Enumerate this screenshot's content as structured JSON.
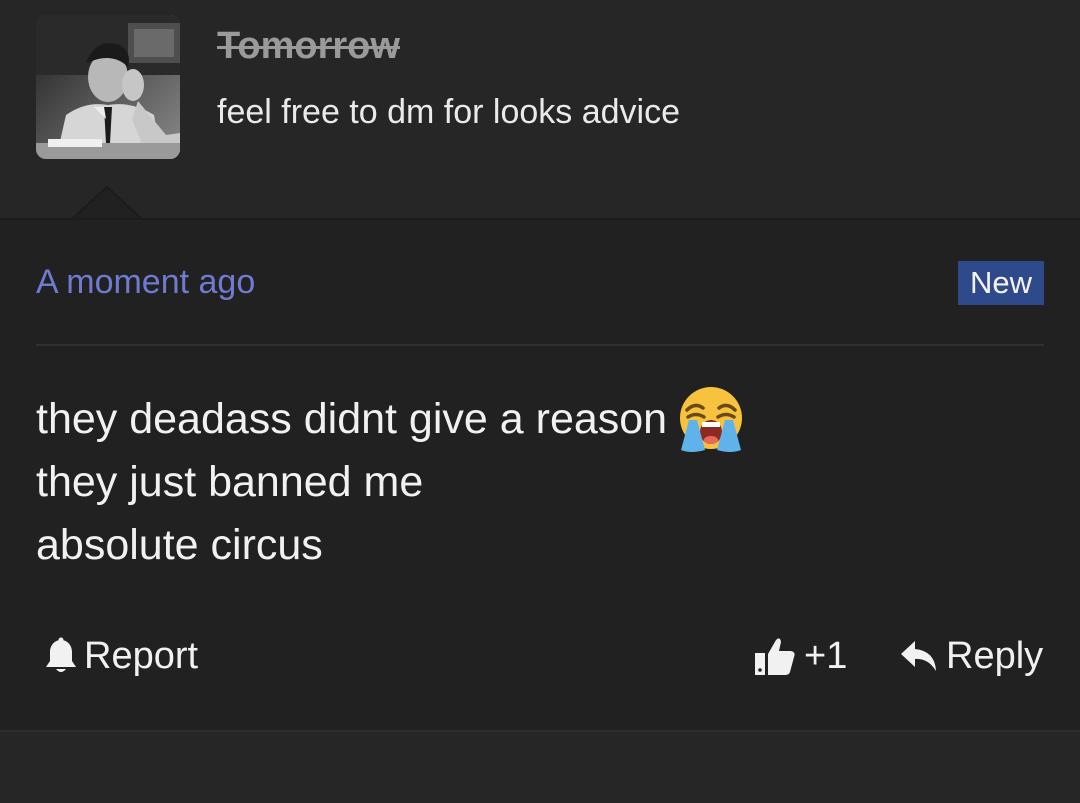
{
  "profile": {
    "username": "Tomorrow",
    "bio": "feel free to dm for looks advice",
    "avatar_icon": "profile-photo"
  },
  "comment": {
    "timestamp": "A moment ago",
    "badge": "New",
    "lines": [
      "they deadass didnt give a reason",
      "they just banned me",
      "absolute circus"
    ],
    "emoji": "loudly-crying-face-emoji"
  },
  "actions": {
    "report_label": "Report",
    "report_icon": "bell-icon",
    "like_count": "+1",
    "like_icon": "thumbs-up-icon",
    "reply_label": "Reply",
    "reply_icon": "reply-arrow-icon"
  },
  "colors": {
    "background": "#262626",
    "card": "#212121",
    "timestamp": "#6f7bd0",
    "badge": "#2f4a8a",
    "text": "#f1f1f1"
  }
}
